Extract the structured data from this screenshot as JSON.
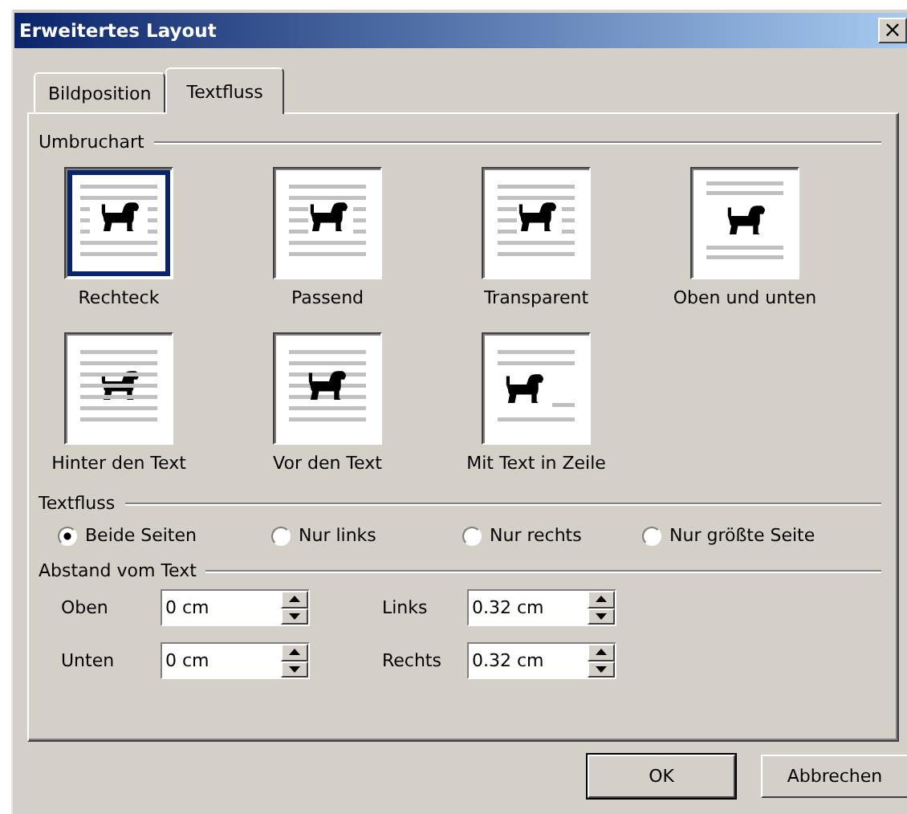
{
  "window": {
    "title": "Erweitertes Layout",
    "close": "×"
  },
  "tabs": [
    {
      "label": "Bildposition",
      "selected": false
    },
    {
      "label": "Textfluss",
      "selected": true
    }
  ],
  "wrap_section": {
    "title": "Umbruchart"
  },
  "wrap_styles": [
    {
      "label": "Rechteck",
      "kind": "square",
      "selected": true
    },
    {
      "label": "Passend",
      "kind": "tight",
      "selected": false
    },
    {
      "label": "Transparent",
      "kind": "through",
      "selected": false
    },
    {
      "label": "Oben und unten",
      "kind": "topbottom",
      "selected": false
    },
    {
      "label": "Hinter den Text",
      "kind": "behind",
      "selected": false
    },
    {
      "label": "Vor den Text",
      "kind": "front",
      "selected": false
    },
    {
      "label": "Mit Text in Zeile",
      "kind": "inline",
      "selected": false
    }
  ],
  "flow_section": {
    "title": "Textfluss"
  },
  "flow_options": [
    {
      "label": "Beide Seiten",
      "selected": true
    },
    {
      "label": "Nur links",
      "selected": false
    },
    {
      "label": "Nur rechts",
      "selected": false
    },
    {
      "label": "Nur größte Seite",
      "selected": false
    }
  ],
  "distance_section": {
    "title": "Abstand vom Text"
  },
  "distance_fields": [
    {
      "label": "Oben",
      "value": "0 cm"
    },
    {
      "label": "Links",
      "value": "0.32 cm"
    },
    {
      "label": "Unten",
      "value": "0 cm"
    },
    {
      "label": "Rechts",
      "value": "0.32 cm"
    }
  ],
  "buttons": [
    {
      "label": "OK",
      "default": true
    },
    {
      "label": "Abbrechen",
      "default": false
    }
  ]
}
